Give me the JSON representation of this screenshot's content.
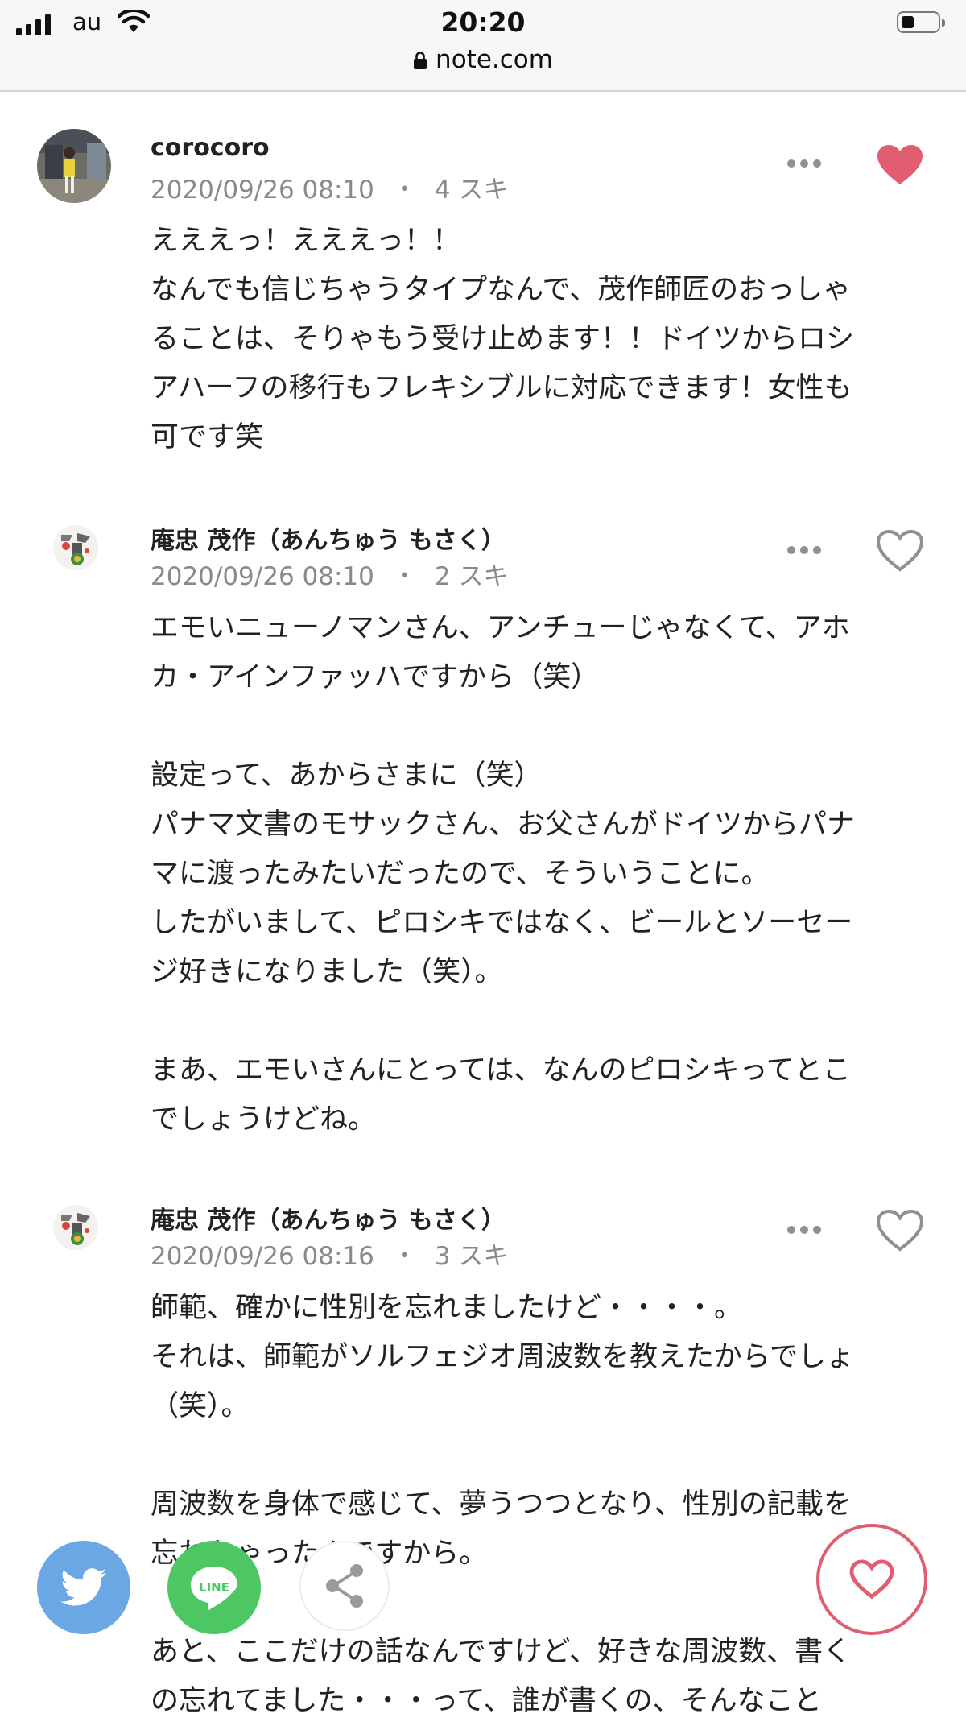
{
  "status_bar": {
    "carrier": "au",
    "time": "20:20",
    "url": "note.com"
  },
  "comments": [
    {
      "author": "corocoro",
      "date": "2020/09/26 08:10",
      "separator": "・",
      "likes": "4 スキ",
      "liked": true,
      "avatar": "photo-avatar",
      "text": "えええっ！えええっ！！\nなんでも信じちゃうタイプなんで、茂作師匠のおっしゃ\nることは、そりゃもう受け止めます！！ドイツからロシ\nアハーフの移行もフレキシブルに対応できます！女性も\n可です笑"
    },
    {
      "author": "庵忠 茂作（あんちゅう もさく）",
      "date": "2020/09/26 08:10",
      "separator": "・",
      "likes": "2 スキ",
      "liked": false,
      "avatar": "illustration-avatar",
      "text": "エモいニューノマンさん、アンチューじゃなくて、アホ\nカ・アインファッハですから（笑）\n\n設定って、あからさまに（笑）\nパナマ文書のモサックさん、お父さんがドイツからパナ\nマに渡ったみたいだったので、そういうことに。\nしたがいまして、ピロシキではなく、ビールとソーセー\nジ好きになりました（笑）。\n\nまあ、エモいさんにとっては、なんのピロシキってとこ\nでしょうけどね。"
    },
    {
      "author": "庵忠 茂作（あんちゅう もさく）",
      "date": "2020/09/26 08:16",
      "separator": "・",
      "likes": "3 スキ",
      "liked": false,
      "avatar": "illustration-avatar",
      "text": "師範、確かに性別を忘れましたけど・・・・。\nそれは、師範がソルフェジオ周波数を教えたからでしょ\n（笑）。\n\n周波数を身体で感じて、夢うつつとなり、性別の記載を\n忘れちゃったんですから。\n\nあと、ここだけの話なんですけど、好きな周波数、書く\nの忘れてました・・・って、誰が書くの、そんなこと"
    }
  ],
  "share_bar": {
    "line_label": "LINE",
    "icons": [
      "twitter-icon",
      "line-icon",
      "share-icon",
      "heart-icon"
    ]
  },
  "colors": {
    "like_active": "#e35d72",
    "meta_gray": "#8a8a8a",
    "twitter": "#6aa7e4",
    "line": "#4cc764"
  }
}
